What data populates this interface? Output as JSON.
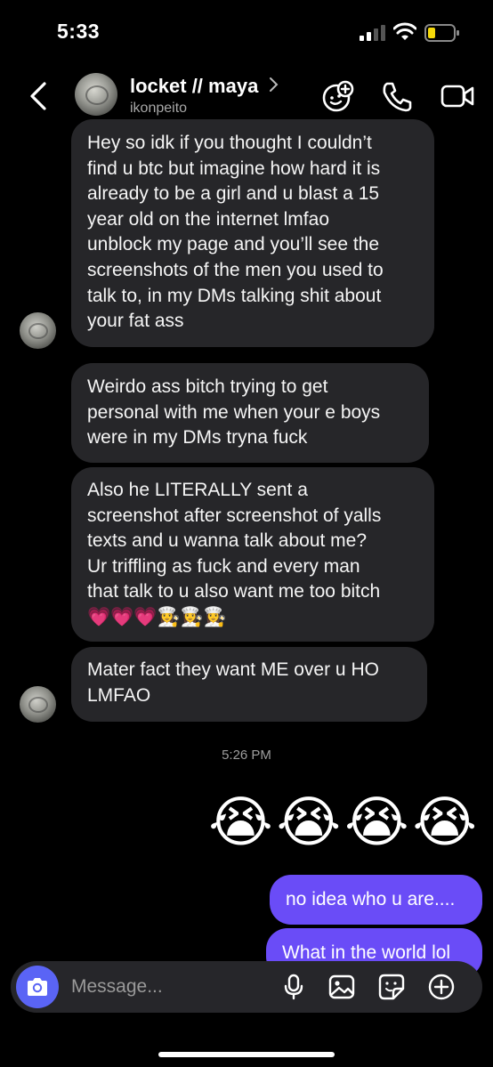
{
  "status_bar": {
    "time": "5:33"
  },
  "header": {
    "name": "locket // maya",
    "username": "ikonpeito",
    "icons": [
      "back-chevron-icon",
      "effects-icon",
      "phone-icon",
      "video-icon"
    ]
  },
  "messages": {
    "received_1": "Hey so idk if you thought I couldn’t\nfind u btc but imagine how hard it is\nalready to be a girl and u blast a 15\nyear old on the internet lmfao\nunblock my page and you’ll see the\nscreenshots of the men you used to\ntalk to, in my DMs talking shit about\nyour fat ass",
    "received_2": "Weirdo ass bitch trying to get\npersonal with me when your e boys\nwere in my DMs tryna fuck",
    "received_3": "Also he LITERALLY sent a\nscreenshot after screenshot of yalls\ntexts and u wanna talk about me?\nUr triffling as fuck and every man\nthat talk to u also want me too bitch\n💗💗💗👩‍🍳👩‍🍳👩‍🍳",
    "received_4": "Mater fact they want ME over u HO\nLMFAO",
    "timestamp": "5:26 PM",
    "emoji_reply": "😭😭😭😭",
    "sent_1": "no idea who u are....",
    "sent_2": "What in the world lol"
  },
  "composer": {
    "placeholder": "Message..."
  },
  "colors": {
    "background": "#000000",
    "received_bubble": "#262629",
    "sent_bubble": "#6a4cf7",
    "camera_button": "#5a64f5"
  }
}
